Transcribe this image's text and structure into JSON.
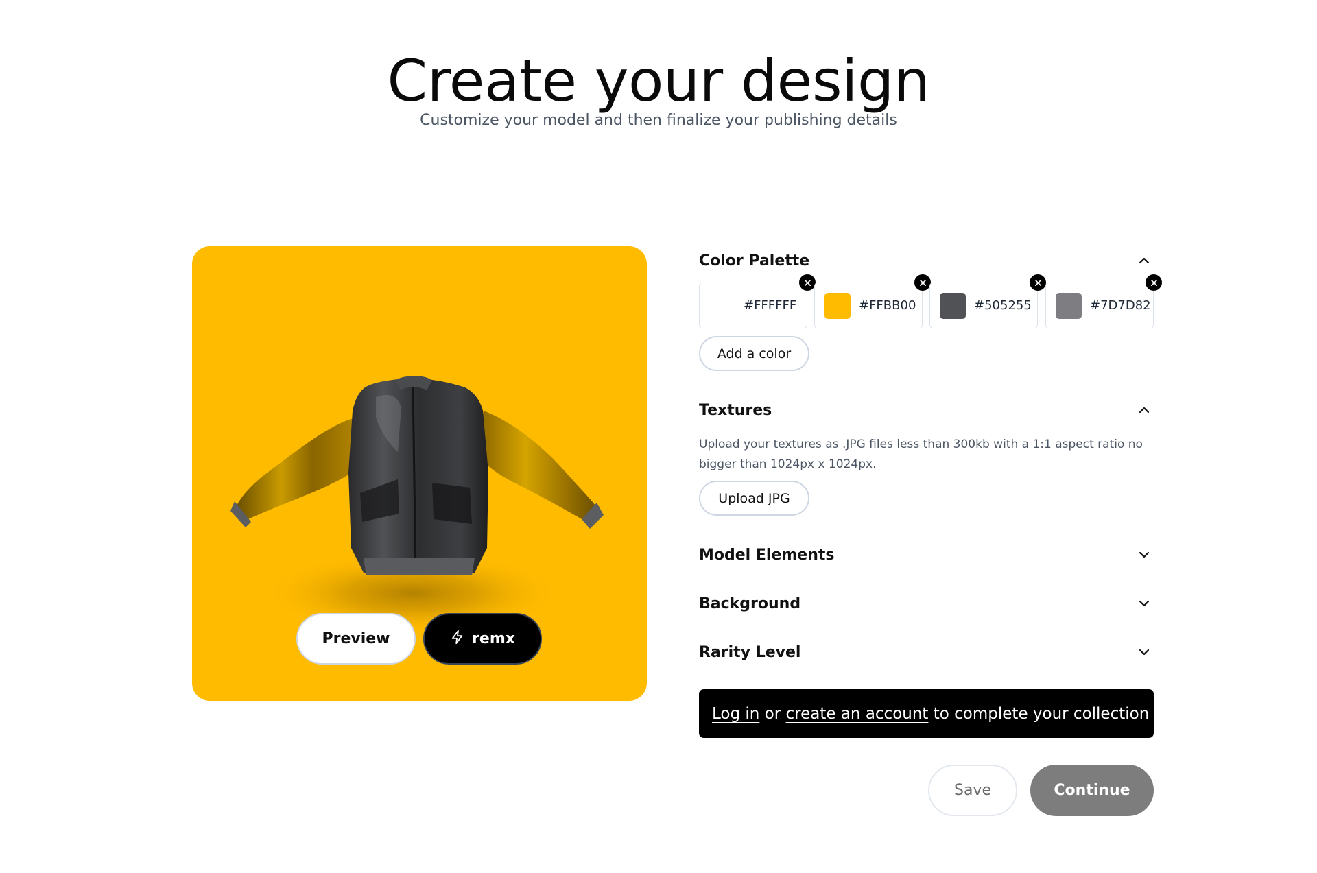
{
  "header": {
    "title": "Create your design",
    "subtitle": "Customize your model and then finalize your publishing details"
  },
  "preview": {
    "background_color": "#FFBB00",
    "model_name": "bomber-jacket",
    "buttons": {
      "preview_label": "Preview",
      "remx_label": "remx",
      "remx_icon": "lightning-bolt-icon"
    }
  },
  "sections": {
    "color_palette": {
      "title": "Color Palette",
      "expanded": true,
      "colors": [
        {
          "hex": "#FFFFFF",
          "value": "#FFFFFF"
        },
        {
          "hex": "#FFBB00",
          "value": "#FFBB00"
        },
        {
          "hex": "#505255",
          "value": "#505255"
        },
        {
          "hex": "#7D7D82",
          "value": "#7D7D82"
        }
      ],
      "add_label": "Add a color"
    },
    "textures": {
      "title": "Textures",
      "expanded": true,
      "description": "Upload your textures as .JPG files less than 300kb with a 1:1 aspect ratio no bigger than 1024px x 1024px.",
      "upload_label": "Upload JPG"
    },
    "model_elements": {
      "title": "Model Elements",
      "expanded": false
    },
    "background": {
      "title": "Background",
      "expanded": false
    },
    "rarity_level": {
      "title": "Rarity Level",
      "expanded": false
    }
  },
  "login_prompt": {
    "login_link": "Log in",
    "or_text": " or ",
    "create_link": "create an account",
    "rest_text": " to complete your collection"
  },
  "footer": {
    "save_label": "Save",
    "continue_label": "Continue"
  },
  "colors": {
    "accent": "#FFBB00",
    "continue_disabled": "#7D7D7D",
    "login_bar": "#000000"
  }
}
